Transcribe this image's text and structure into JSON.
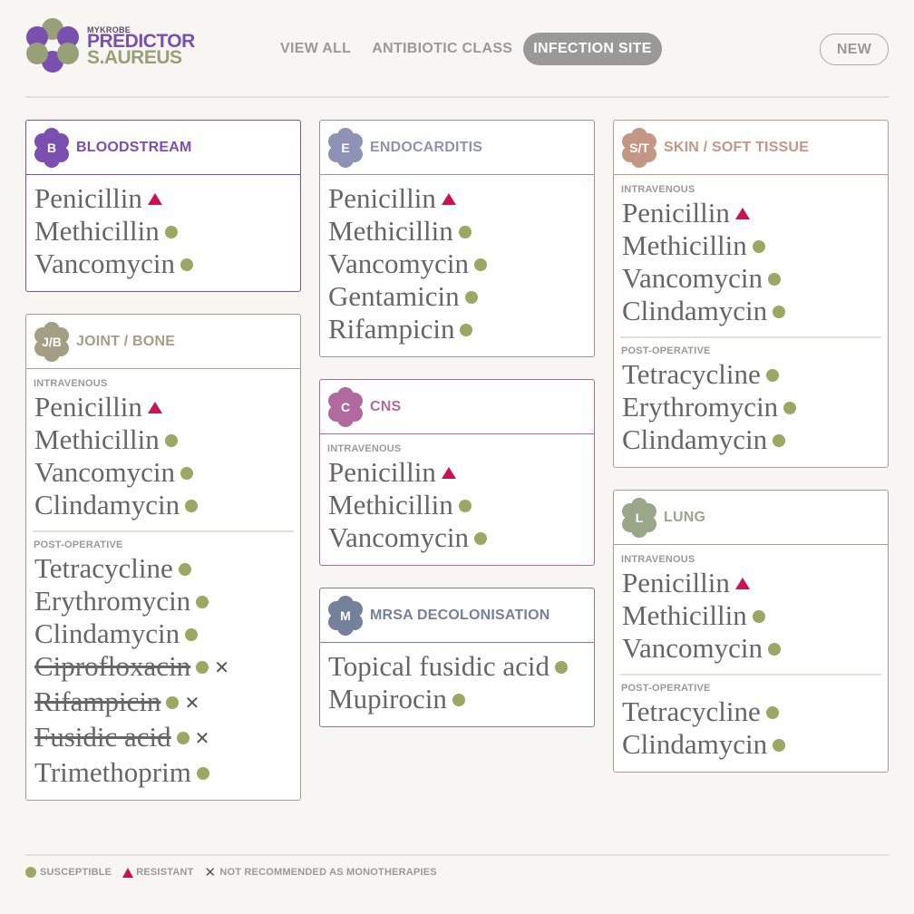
{
  "logo": {
    "small_text": "MYKROBE",
    "line1": "PREDICTOR",
    "line2": "S.AUREUS",
    "colors": {
      "purple": "#7a4fb0",
      "green": "#98a077"
    }
  },
  "nav": {
    "view_all": "VIEW ALL",
    "antibiotic_class": "ANTIBIOTIC CLASS",
    "infection_site": "INFECTION SITE",
    "active": "infection_site"
  },
  "new_button": "NEW",
  "icons": {
    "susceptible": "dot",
    "resistant": "triangle",
    "not_recommended": "x-mark"
  },
  "colors": {
    "susceptible": "#99a862",
    "resistant": "#c8144f"
  },
  "cards": {
    "bloodstream": {
      "badge": "B",
      "title": "BLOODSTREAM",
      "color": "#7a4fb0",
      "sections": [
        {
          "label": "",
          "drugs": [
            {
              "name": "Penicillin",
              "status": "resistant"
            },
            {
              "name": "Methicillin",
              "status": "susceptible"
            },
            {
              "name": "Vancomycin",
              "status": "susceptible"
            }
          ]
        }
      ]
    },
    "joint_bone": {
      "badge": "J/B",
      "title": "JOINT / BONE",
      "color": "#a59e86",
      "sections": [
        {
          "label": "INTRAVENOUS",
          "drugs": [
            {
              "name": "Penicillin",
              "status": "resistant"
            },
            {
              "name": "Methicillin",
              "status": "susceptible"
            },
            {
              "name": "Vancomycin",
              "status": "susceptible"
            },
            {
              "name": "Clindamycin",
              "status": "susceptible"
            }
          ]
        },
        {
          "label": "POST-OPERATIVE",
          "drugs": [
            {
              "name": "Tetracycline",
              "status": "susceptible"
            },
            {
              "name": "Erythromycin",
              "status": "susceptible"
            },
            {
              "name": "Clindamycin",
              "status": "susceptible"
            },
            {
              "name": "Ciprofloxacin",
              "status": "susceptible",
              "not_recommended": true
            },
            {
              "name": "Rifampicin",
              "status": "susceptible",
              "not_recommended": true
            },
            {
              "name": "Fusidic acid",
              "status": "susceptible",
              "not_recommended": true
            },
            {
              "name": "Trimethoprim",
              "status": "susceptible"
            }
          ]
        }
      ]
    },
    "endocarditis": {
      "badge": "E",
      "title": "ENDOCARDITIS",
      "color": "#8e93b5",
      "sections": [
        {
          "label": "",
          "drugs": [
            {
              "name": "Penicillin",
              "status": "resistant"
            },
            {
              "name": "Methicillin",
              "status": "susceptible"
            },
            {
              "name": "Vancomycin",
              "status": "susceptible"
            },
            {
              "name": "Gentamicin",
              "status": "susceptible"
            },
            {
              "name": "Rifampicin",
              "status": "susceptible"
            }
          ]
        }
      ]
    },
    "cns": {
      "badge": "C",
      "title": "CNS",
      "color": "#b06aa0",
      "sections": [
        {
          "label": "INTRAVENOUS",
          "drugs": [
            {
              "name": "Penicillin",
              "status": "resistant"
            },
            {
              "name": "Methicillin",
              "status": "susceptible"
            },
            {
              "name": "Vancomycin",
              "status": "susceptible"
            }
          ]
        }
      ]
    },
    "mrsa": {
      "badge": "M",
      "title": "MRSA DECOLONISATION",
      "color": "#75809a",
      "sections": [
        {
          "label": "",
          "drugs": [
            {
              "name": "Topical fusidic acid",
              "status": "susceptible"
            },
            {
              "name": "Mupirocin",
              "status": "susceptible"
            }
          ]
        }
      ]
    },
    "skin": {
      "badge": "S/T",
      "title": "SKIN / SOFT TISSUE",
      "color": "#c49685",
      "sections": [
        {
          "label": "INTRAVENOUS",
          "drugs": [
            {
              "name": "Penicillin",
              "status": "resistant"
            },
            {
              "name": "Methicillin",
              "status": "susceptible"
            },
            {
              "name": "Vancomycin",
              "status": "susceptible"
            },
            {
              "name": "Clindamycin",
              "status": "susceptible"
            }
          ]
        },
        {
          "label": "POST-OPERATIVE",
          "drugs": [
            {
              "name": "Tetracycline",
              "status": "susceptible"
            },
            {
              "name": "Erythromycin",
              "status": "susceptible"
            },
            {
              "name": "Clindamycin",
              "status": "susceptible"
            }
          ]
        }
      ]
    },
    "lung": {
      "badge": "L",
      "title": "LUNG",
      "color": "#9aa68a",
      "sections": [
        {
          "label": "INTRAVENOUS",
          "drugs": [
            {
              "name": "Penicillin",
              "status": "resistant"
            },
            {
              "name": "Methicillin",
              "status": "susceptible"
            },
            {
              "name": "Vancomycin",
              "status": "susceptible"
            }
          ]
        },
        {
          "label": "POST-OPERATIVE",
          "drugs": [
            {
              "name": "Tetracycline",
              "status": "susceptible"
            },
            {
              "name": "Clindamycin",
              "status": "susceptible"
            }
          ]
        }
      ]
    }
  },
  "legend": {
    "susceptible": "SUSCEPTIBLE",
    "resistant": "RESISTANT",
    "not_recommended": "NOT RECOMMENDED AS MONOTHERAPIES"
  }
}
